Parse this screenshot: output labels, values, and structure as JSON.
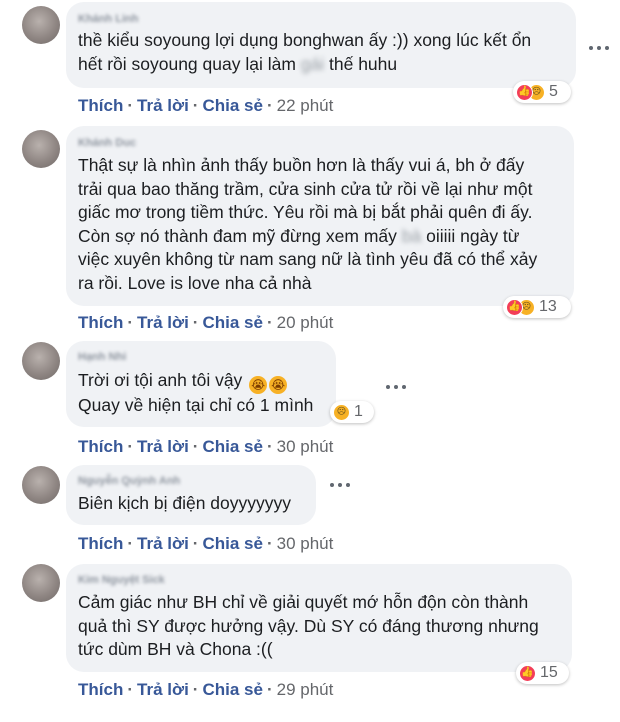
{
  "actions": {
    "like": "Thích",
    "reply": "Trả lời",
    "share": "Chia sẻ"
  },
  "comments": [
    {
      "author": "Khánh Linh",
      "text_a": "thề kiểu soyoung lợi dụng bonghwan ấy :)) xong lúc kết ổn\nhết rồi soyoung quay lại làm ",
      "text_blur": "gái",
      "text_b": " thế huhu",
      "reactions": [
        "like-icon",
        "sad-icon"
      ],
      "reaction_count": "5",
      "time": "22 phút"
    },
    {
      "author": "Khánh Duc",
      "text_a": "Thật sự là nhìn ảnh thấy buồn hơn là thấy vui á, bh ở đấy\ntrải qua bao thăng trầm, cửa sinh cửa tử rồi về lại như một\ngiấc mơ trong tiềm thức. Yêu rồi mà bị bắt phải quên đi ấy.\nCòn sợ nó thành đam mỹ đừng xem mấy ",
      "text_blur": "bà",
      "text_b": " oiiiii ngày từ\nviệc xuyên không từ nam sang nữ là tình yêu đã có thể xảy\nra rồi. Love is love nha cả nhà",
      "reactions": [
        "like-icon",
        "sad-icon"
      ],
      "reaction_count": "13",
      "time": "20 phút"
    },
    {
      "author": "Hạnh Nhi",
      "line1": "Trời ơi tội anh tôi vậy",
      "line2": "Quay về hiện tại chỉ có 1 mình",
      "reactions": [
        "sad-icon"
      ],
      "reaction_count": "1",
      "time": "30 phút"
    },
    {
      "author": "Nguyễn Quỳnh Anh",
      "text": "Biên kịch bị điện doyyyyyyy",
      "time": "30 phút"
    },
    {
      "author": "Kim Nguyệt Sick",
      "text": "Cảm giác như BH chỉ về giải quyết mớ hỗn độn còn thành\nquả thì SY được hưởng vậy. Dù SY có đáng thương nhưng\ntức dùm BH và Chona :((",
      "reactions": [
        "like-icon"
      ],
      "reaction_count": "15",
      "time": "29 phút"
    }
  ]
}
